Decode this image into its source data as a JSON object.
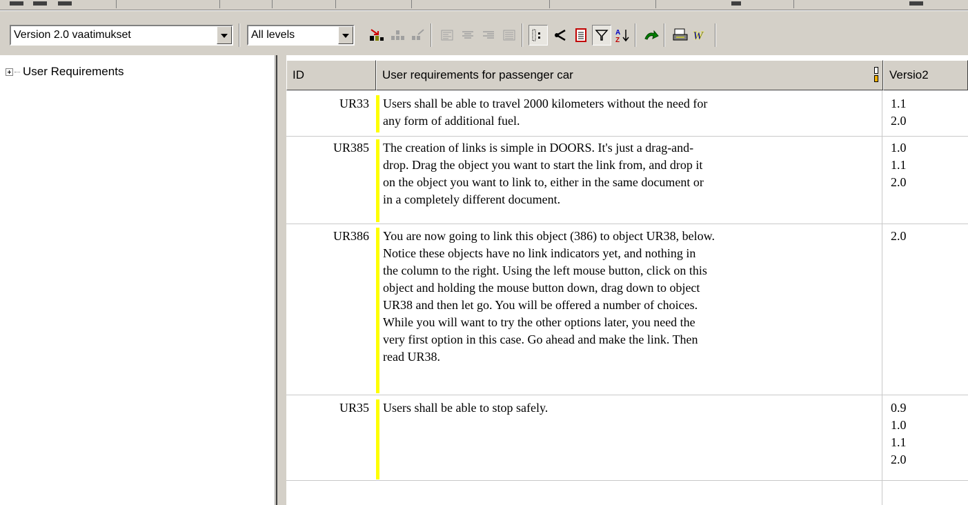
{
  "toolbar": {
    "view_combo_value": "Version 2.0 vaatimukset",
    "level_combo_value": "All levels"
  },
  "tree": {
    "root_label": "User Requirements"
  },
  "table": {
    "columns": [
      "ID",
      "User requirements for passenger car",
      "Versio2"
    ],
    "rows": [
      {
        "id": "UR33",
        "text": "Users shall be able to travel 2000 kilometers without the need for\nany form of additional fuel.",
        "versions": "1.1\n2.0"
      },
      {
        "id": "UR385",
        "text": "The creation of links is simple in DOORS. It's just a drag-and-\ndrop. Drag the object you want to start the link from, and drop it\non the object you want to link to, either in the same document or\nin a completely different document.",
        "versions": "1.0\n1.1\n2.0"
      },
      {
        "id": "UR386",
        "text": "You are now going to link this object (386) to object UR38, below.\nNotice these objects have no link indicators yet, and nothing in\nthe column to the right. Using the left mouse button, click on this\nobject and holding the mouse button down, drag down to object\nUR38 and then let go. You will be offered a number of choices.\nWhile you will want to try the other options later, you need the\nvery first option in this case. Go ahead and make the link. Then\nread UR38.",
        "versions": "2.0"
      },
      {
        "id": "UR35",
        "text": "Users shall be able to stop safely.",
        "versions": "0.9\n1.0\n1.1\n2.0"
      }
    ]
  },
  "colors": {
    "chrome": "#d4d0c8",
    "change_bar": "#ffff00"
  },
  "icons": [
    "insert-object-icon",
    "insert-below-icon",
    "delete-object-icon",
    "align-left-icon",
    "align-center-icon",
    "align-right-icon",
    "align-justify-icon",
    "show-outline-icon",
    "links-icon",
    "document-icon",
    "filter-icon",
    "sort-icon",
    "follow-link-icon",
    "print-icon",
    "word-export-icon"
  ]
}
